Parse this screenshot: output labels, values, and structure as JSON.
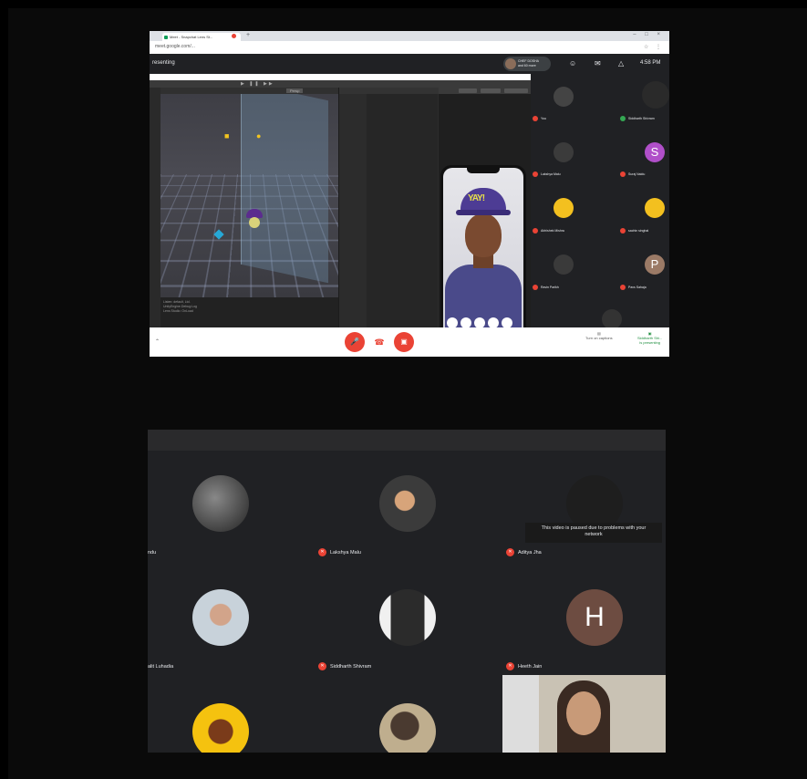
{
  "browser": {
    "tab_title": "Meet - Snapchat Lens St...",
    "address": "meet.google.com/...",
    "window_controls": "– □ ×",
    "address_icons": "☆ ⋮",
    "new_tab": "+"
  },
  "meet": {
    "title": "resenting",
    "presenter_line1": "CHEF DOSHA",
    "presenter_line2": "and 60 more",
    "time": "4:58 PM",
    "toolbar_icons": [
      "people-icon",
      "chat-icon",
      "activities-icon"
    ]
  },
  "unity": {
    "scene_tab": "Persp",
    "toolbar_center": "▶ ❚❚ ▶▶",
    "console_lines": [
      "Listen: default, Ltd.",
      "UnityEngine.Debug:Log",
      "Lens Studio: OnLoad"
    ]
  },
  "top_participants": [
    {
      "name": "You",
      "avatar_color": "#444"
    },
    {
      "name": "Siddharth Shivram",
      "avatar_color": "#2a2a2a"
    },
    {
      "name": "Lakshya Malu",
      "avatar_color": "#3b3b3b"
    },
    {
      "name": "Suraj Naidu",
      "avatar_color": "#b04fc9",
      "letter": "S"
    },
    {
      "name": "Abhishek Mishra",
      "avatar_color": "#f3c01f"
    },
    {
      "name": "sachin singhal",
      "avatar_color": "#f3c01f"
    },
    {
      "name": "Ravin Parikh",
      "avatar_color": "#3a3a3a"
    },
    {
      "name": "Pavs Sahaja",
      "avatar_color": "#9b7a66",
      "letter": "P"
    }
  ],
  "bottom_bar": {
    "turn_on_captions": "Turn on captions",
    "presenting_label_1": "Siddharth Shi...",
    "presenting_label_2": "is presenting"
  },
  "bottom_participants": [
    {
      "name": "ndu",
      "avatar_color": "#444"
    },
    {
      "name": "Lakshya Malu",
      "avatar_color": "#3b3b3b"
    },
    {
      "name": "Aditya Jha",
      "avatar_color": "#1e1e1e"
    },
    {
      "name": "alit Luhadia",
      "avatar_color": "#5a6b7a"
    },
    {
      "name": "Siddharth Shivram",
      "avatar_color": "#2b2b2b"
    },
    {
      "name": "Heeth Jain",
      "avatar_color": "#6d4c41",
      "letter": "H"
    }
  ],
  "paused_message_line1": "This video is paused due to problems with your",
  "paused_message_line2": "network"
}
